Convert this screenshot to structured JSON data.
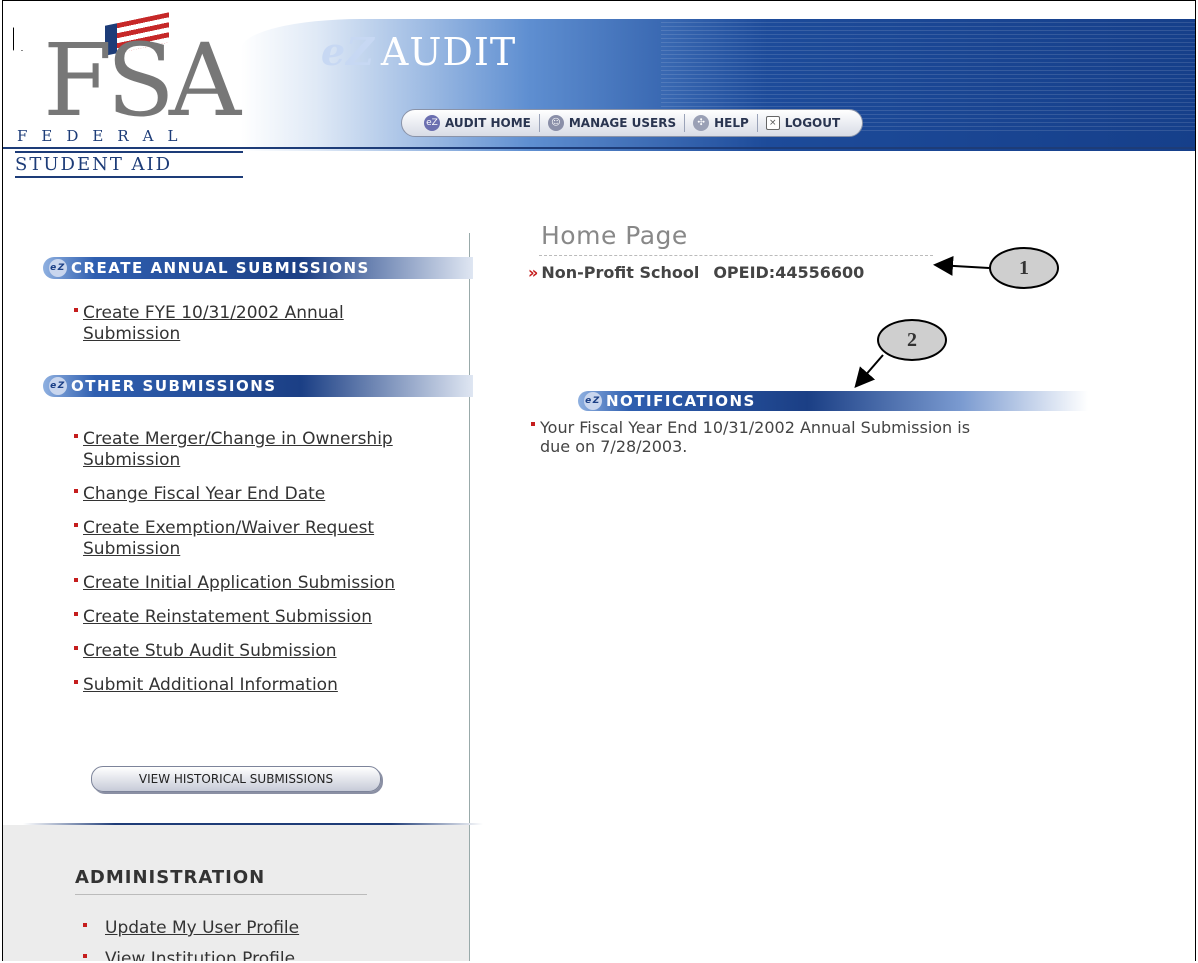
{
  "header": {
    "logo_main": "FSA",
    "logo_federal": "FEDERAL",
    "logo_student": "STUDENT AID",
    "brand_prefix": "eZ",
    "brand_name": "AUDIT",
    "nav": [
      {
        "label": "AUDIT HOME",
        "icon": "ez-icon"
      },
      {
        "label": "MANAGE USERS",
        "icon": "users-icon"
      },
      {
        "label": "HELP",
        "icon": "help-icon"
      },
      {
        "label": "LOGOUT",
        "icon": "logout-icon"
      }
    ]
  },
  "sidebar": {
    "annual": {
      "heading": "CREATE ANNUAL SUBMISSIONS",
      "links": [
        "Create FYE 10/31/2002 Annual Submission"
      ]
    },
    "other": {
      "heading": "OTHER SUBMISSIONS",
      "links": [
        "Create Merger/Change in Ownership Submission",
        "Change Fiscal Year End Date",
        "Create Exemption/Waiver Request Submission",
        "Create Initial Application Submission",
        "Create Reinstatement Submission",
        "Create Stub Audit Submission",
        "Submit Additional Information"
      ],
      "button": "VIEW HISTORICAL SUBMISSIONS"
    },
    "admin": {
      "heading": "ADMINISTRATION",
      "links": [
        "Update My User Profile",
        "View Institution Profile"
      ]
    }
  },
  "main": {
    "title": "Home Page",
    "school_name": "Non-Profit School",
    "opeid": "OPEID:44556600",
    "notifications_heading": "NOTIFICATIONS",
    "notification": "Your Fiscal Year End 10/31/2002 Annual Submission is due on 7/28/2003."
  },
  "callouts": [
    "1",
    "2"
  ],
  "colors": {
    "banner": "#1b3f85",
    "bullet": "#c51d1d",
    "admin_bg": "#ececec"
  }
}
